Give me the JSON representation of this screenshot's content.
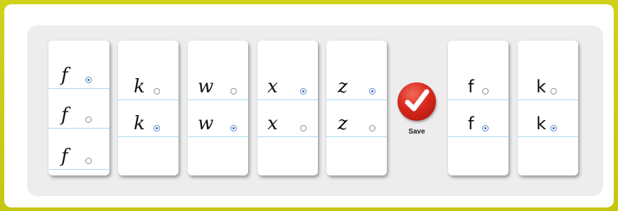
{
  "exercise": {
    "columns": [
      {
        "rows": [
          {
            "glyph": "f",
            "checked": true
          },
          {
            "glyph": "f",
            "checked": false
          },
          {
            "glyph": "f",
            "checked": false
          }
        ]
      },
      {
        "rows": [
          {
            "glyph": "k",
            "checked": false
          },
          {
            "glyph": "k",
            "checked": true
          }
        ]
      },
      {
        "rows": [
          {
            "glyph": "w",
            "checked": false
          },
          {
            "glyph": "w",
            "checked": true
          }
        ]
      },
      {
        "rows": [
          {
            "glyph": "x",
            "checked": true
          },
          {
            "glyph": "x",
            "checked": false
          }
        ]
      },
      {
        "rows": [
          {
            "glyph": "z",
            "checked": true
          },
          {
            "glyph": "z",
            "checked": false
          }
        ]
      }
    ],
    "save_label": "Save",
    "preview": [
      {
        "rows": [
          {
            "glyph": "f",
            "checked": false
          },
          {
            "glyph": "f",
            "checked": true
          }
        ]
      },
      {
        "rows": [
          {
            "glyph": "k",
            "checked": false
          },
          {
            "glyph": "k",
            "checked": true
          }
        ]
      }
    ]
  },
  "colors": {
    "background": "#cfd21a",
    "save": "#d8281c",
    "radio_checked": "#2f5fb8",
    "ruling": "#a8d8f0"
  },
  "icons": {
    "save": "check-mark-icon"
  }
}
